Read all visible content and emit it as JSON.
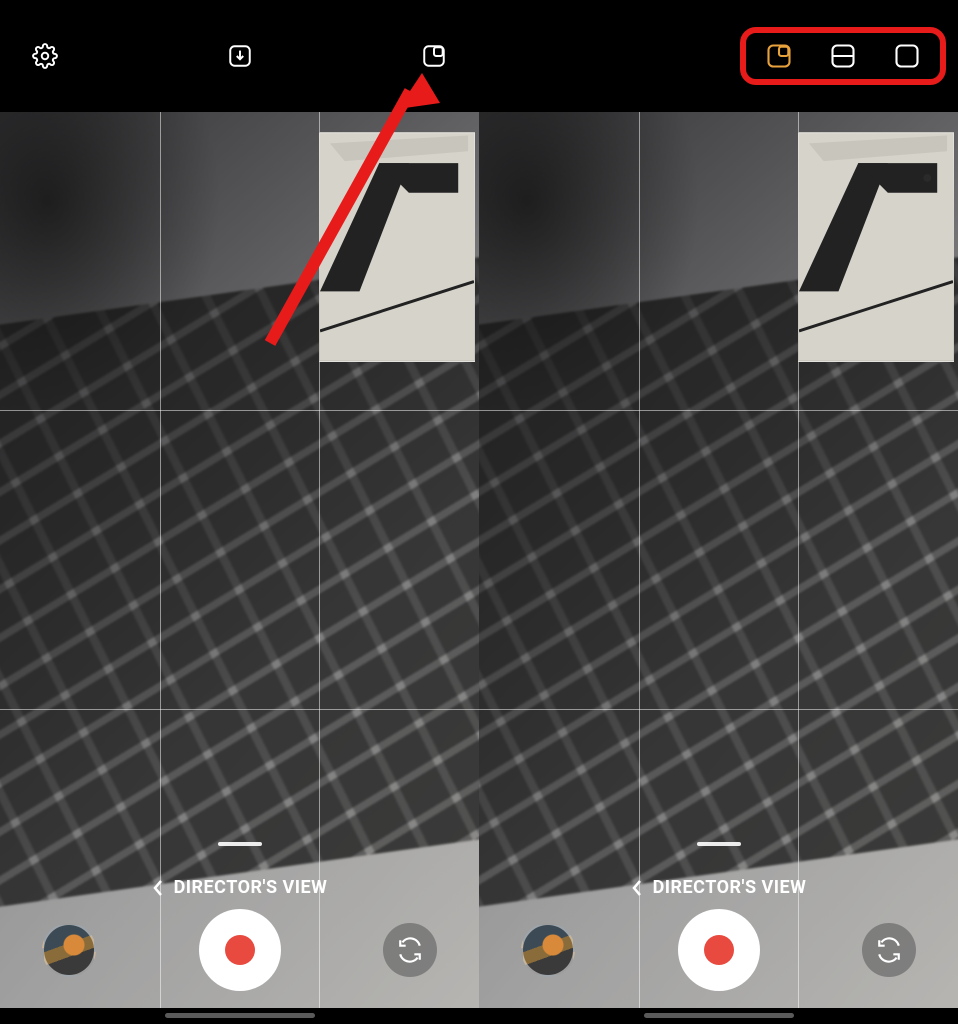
{
  "left": {
    "top_icons": {
      "settings": "gear-icon",
      "save": "download-icon",
      "layout": "pip-layout-icon"
    },
    "mode_label": "DIRECTOR'S VIEW"
  },
  "right": {
    "layout_options": {
      "pip": "pip-layout-icon",
      "split": "split-layout-icon",
      "single": "single-layout-icon",
      "selected": "pip"
    },
    "mode_label": "DIRECTOR'S VIEW"
  },
  "colors": {
    "accent": "#e8a23c",
    "annotation": "#e81b1b",
    "record": "#e84a3f"
  }
}
